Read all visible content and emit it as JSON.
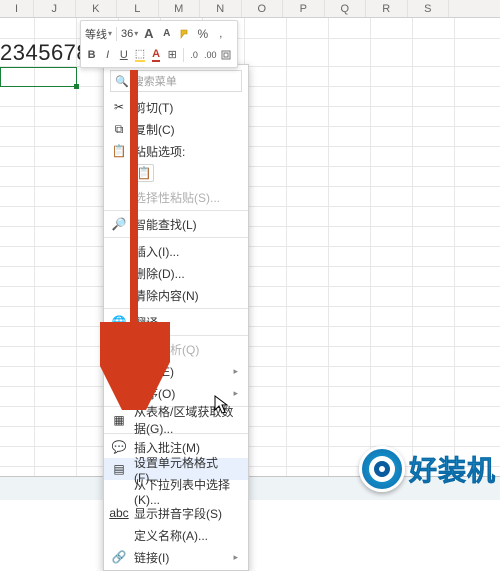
{
  "columns": [
    "I",
    "J",
    "K",
    "L",
    "M",
    "N",
    "O",
    "P",
    "Q",
    "R",
    "S"
  ],
  "cell_value": "2345678",
  "mini_toolbar": {
    "font": "等线",
    "size": "36",
    "btn_increase": "A",
    "btn_decrease": "A",
    "format_painter": "✎",
    "percent": "%",
    "comma": ",",
    "bold": "B",
    "italic": "I",
    "underline": "U",
    "fill": "⬚",
    "font_color": "A",
    "border": "⊞",
    "decimal_inc": ".0",
    "decimal_dec": ".00"
  },
  "ctx": {
    "search_ph": "搜索菜单",
    "cut": "剪切(T)",
    "copy": "复制(C)",
    "paste_header": "粘贴选项:",
    "paste_special": "选择性粘贴(S)...",
    "smart_lookup": "智能查找(L)",
    "insert": "插入(I)...",
    "delete": "删除(D)...",
    "clear": "清除内容(N)",
    "translate": "翻译",
    "quick_analysis": "快速分析(Q)",
    "filter": "筛选(E)",
    "sort": "排序(O)",
    "get_data": "从表格/区域获取数据(G)...",
    "comment": "插入批注(M)",
    "format_cells": "设置单元格格式(F)...",
    "pick_from_list": "从下拉列表中选择(K)...",
    "phonetic": "显示拼音字段(S)",
    "define_name": "定义名称(A)...",
    "link": "链接(I)"
  },
  "watermark_text": "好装机"
}
